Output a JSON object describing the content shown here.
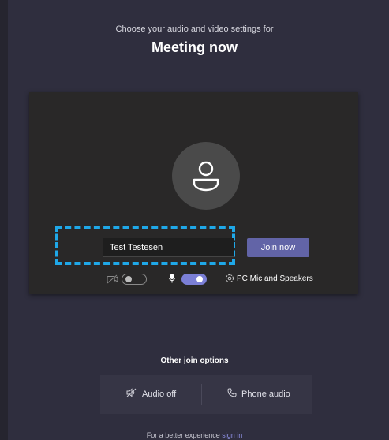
{
  "header": {
    "subtitle": "Choose your audio and video settings for",
    "title": "Meeting now"
  },
  "prejoin": {
    "name_value": "Test Testesen",
    "join_label": "Join now"
  },
  "controls": {
    "video_on": false,
    "mic_on": true,
    "device_label": "PC Mic and Speakers"
  },
  "other_options": {
    "title": "Other join options",
    "audio_off_label": "Audio off",
    "phone_audio_label": "Phone audio"
  },
  "footer": {
    "text": "For a better experience",
    "link_label": "sign in"
  },
  "colors": {
    "accent": "#6264a7",
    "highlight": "#1fa8e8",
    "background": "#2f2e3e"
  }
}
